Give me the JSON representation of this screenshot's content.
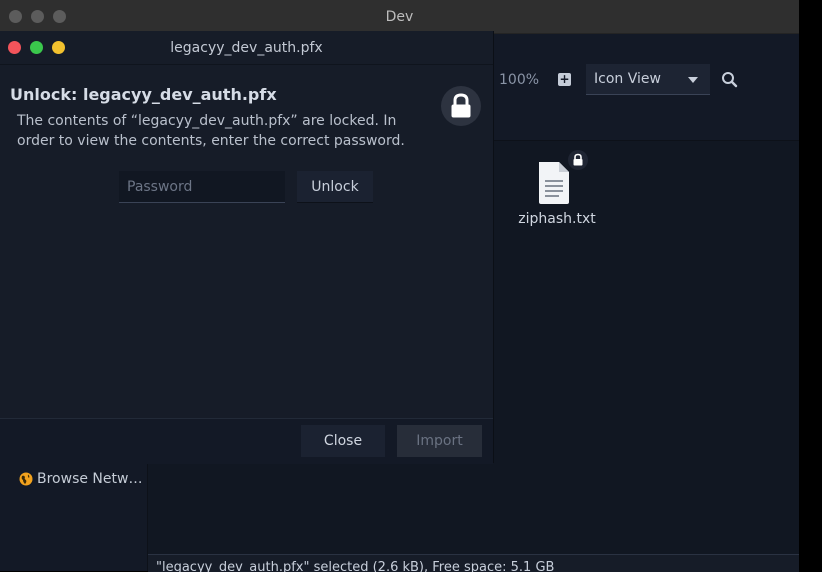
{
  "background_window": {
    "title": "Dev",
    "toolbar": {
      "zoom": "100%",
      "view_mode": "Icon View"
    },
    "sidebar": {
      "items": [
        {
          "label": "Browse Netw…",
          "icon": "globe-icon"
        }
      ]
    },
    "files": [
      {
        "name": "ziphash.txt",
        "icon": "text-file-icon",
        "locked": true
      }
    ],
    "status": "\"legacyy_dev_auth.pfx\" selected (2.6 kB), Free space: 5.1 GB"
  },
  "dialog": {
    "title": "legacyy_dev_auth.pfx",
    "heading": "Unlock: legacyy_dev_auth.pfx",
    "message": "The contents of “legacyy_dev_auth.pfx” are locked. In order to view the contents, enter the correct password.",
    "password_placeholder": "Password",
    "password_value": "",
    "unlock_label": "Unlock",
    "close_label": "Close",
    "import_label": "Import",
    "icon": "lock-icon"
  },
  "colors": {
    "window_bg": "#161c28",
    "traffic_close": "#f2545b",
    "traffic_maximize": "#3ac74c",
    "traffic_minimize": "#f2c12e"
  }
}
